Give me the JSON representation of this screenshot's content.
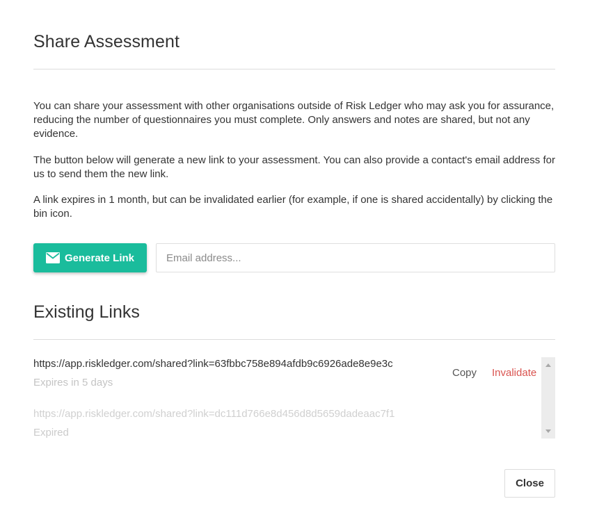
{
  "dialog": {
    "title": "Share Assessment",
    "paragraphs": [
      "You can share your assessment with other organisations outside of Risk Ledger who may ask you for assurance, reducing the number of questionnaires you must complete. Only answers and notes are shared, but not any evidence.",
      "The button below will generate a new link to your assessment. You can also provide a contact's email address for us to send them the new link.",
      "A link expires in 1 month, but can be invalidated earlier (for example, if one is shared accidentally) by clicking the bin icon."
    ],
    "generate_button_label": "Generate Link",
    "generate_button_icon": "envelope-icon",
    "email_placeholder": "Email address...",
    "email_value": "",
    "existing_links_title": "Existing Links",
    "links": [
      {
        "url": "https://app.riskledger.com/shared?link=63fbbc758e894afdb9c6926ade8e9e3c",
        "status": "Expires in 5 days",
        "copy_label": "Copy",
        "invalidate_label": "Invalidate"
      },
      {
        "url": "https://app.riskledger.com/shared?link=dc111d766e8d456d8d5659dadeaac7f1",
        "status": "Expired"
      }
    ],
    "close_button_label": "Close"
  },
  "colors": {
    "accent": "#1abc9c",
    "danger": "#d9534f",
    "text": "#333333",
    "muted": "#c4c4c4",
    "divider": "#dcdcdc"
  }
}
